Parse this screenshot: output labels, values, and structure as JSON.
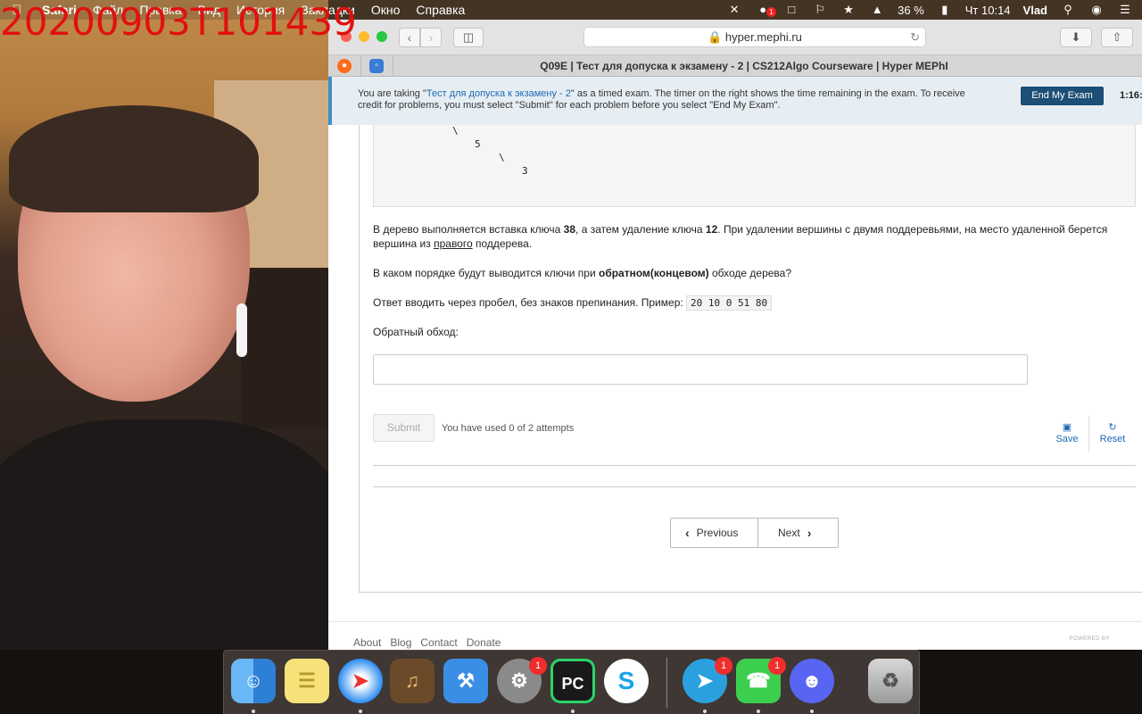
{
  "overlay": {
    "timestamp": "20200903T101439"
  },
  "menubar": {
    "items": [
      "Safari",
      "Файл",
      "Правка",
      "Вид",
      "История",
      "Закладки",
      "Окно",
      "Справка"
    ],
    "status": {
      "battery": "36 %",
      "clock": "Чт 10:14",
      "user": "Vlad",
      "notification_count": "1"
    }
  },
  "browser": {
    "url": "hyper.mephi.ru",
    "tab_title": "Q09E | Тест для допуска к экзамену - 2 | CS212Algo Courseware | Hyper MEPhI"
  },
  "banner": {
    "pre": "You are taking \"",
    "link": "Тест для допуска к экзамену - 2",
    "post": "\" as a timed exam. The timer on the right shows the time remaining in the exam. To receive credit for problems, you must select \"Submit\" for each problem before you select \"End My Exam\".",
    "end_exam": "End My Exam",
    "timer": "1:16:"
  },
  "problem": {
    "tree": {
      "slash1": "\\",
      "n5": "5",
      "slash2": "\\",
      "n3": "3"
    },
    "p1_a": "В дерево выполняется вставка ключа ",
    "p1_k1": "38",
    "p1_b": ", а затем удаление ключа ",
    "p1_k2": "12",
    "p1_c": ". При удалении вершины с двумя поддеревьями, на место удаленной берется вершина из ",
    "p1_u": "правого",
    "p1_d": " поддерева.",
    "p2_a": "В каком порядке будут выводится ключи при ",
    "p2_b": "обратном(концевом)",
    "p2_c": " обходе дерева?",
    "p3": "Ответ вводить через пробел, без знаков препинания. Пример: ",
    "p3_code": "20 10 0 51 80",
    "label": "Обратный обход:",
    "answer_value": "",
    "submit": "Submit",
    "attempts": "You have used 0 of 2 attempts",
    "save": "Save",
    "reset": "Reset"
  },
  "pager": {
    "previous": "Previous",
    "next": "Next"
  },
  "footer": {
    "links": [
      "About",
      "Blog",
      "Contact",
      "Donate"
    ],
    "powered": "POWERED BY"
  },
  "dock": {
    "apps": [
      "Finder",
      "Notes",
      "Safari",
      "GarageBand",
      "Xcode",
      "System Preferences",
      "PyCharm",
      "Skype",
      "Telegram",
      "FaceTime",
      "Discord",
      "Trash"
    ],
    "badges": {
      "system_preferences": "1",
      "telegram": "1",
      "facetime": "1"
    },
    "pycharm_label": "PC"
  }
}
